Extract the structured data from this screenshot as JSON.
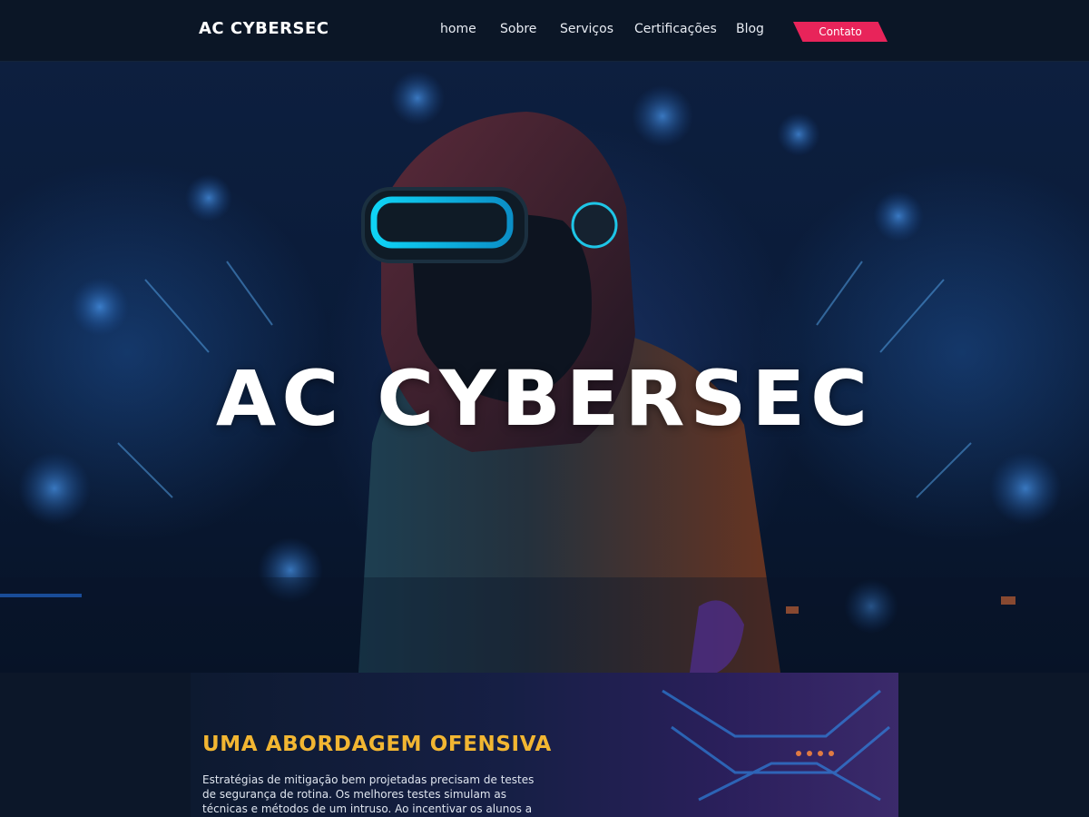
{
  "navbar": {
    "brand": "AC CYBERSEC",
    "links": [
      {
        "label": "home"
      },
      {
        "label": "Sobre"
      },
      {
        "label": "Serviços"
      },
      {
        "label": "Certificações"
      },
      {
        "label": "Blog"
      }
    ],
    "cta_label": "Contato",
    "cta_color": "#e8245a"
  },
  "hero": {
    "title": "AC CYBERSEC",
    "image_subject": "hooded-hacker-vr-headset",
    "accent_color": "#19c8e8"
  },
  "about": {
    "heading": "UMA ABORDAGEM OFENSIVA",
    "heading_color": "#f2b632",
    "paragraph": "Estratégias de mitigação bem projetadas precisam de testes de segurança de rotina. Os melhores testes simulam as técnicas e métodos de um intruso. Ao incentivar os alunos a usar as"
  },
  "icons": {
    "logo": "wordmark-logo",
    "hero_figure": "hacker-figure-icon"
  }
}
